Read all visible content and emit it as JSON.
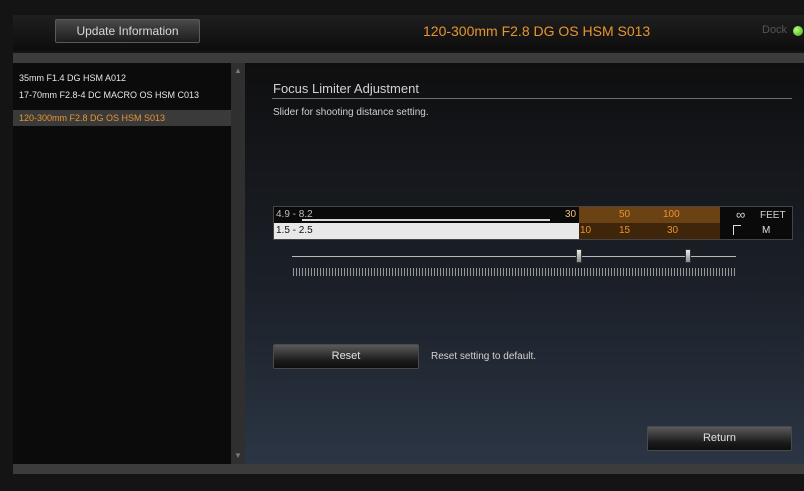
{
  "header": {
    "update_button": "Update Information",
    "lens_title": "120-300mm F2.8 DG OS HSM S013",
    "dock_label": "Dock",
    "dock_status_color": "#4fc21e"
  },
  "sidebar": {
    "items": [
      {
        "label": "35mm F1.4 DG HSM A012",
        "selected": false
      },
      {
        "label": "17-70mm F2.8-4 DC MACRO OS HSM C013",
        "selected": false
      },
      {
        "label": "120-300mm F2.8 DG OS HSM S013",
        "selected": true
      }
    ],
    "scroll_up_icon": "arrow-up-icon",
    "scroll_down_icon": "arrow-down-icon"
  },
  "main": {
    "section_title": "Focus Limiter Adjustment",
    "section_desc": "Slider for shooting distance setting.",
    "scale": {
      "feet_row_left": "4.9 - 8.2",
      "meter_row_left": "1.5 - 2.5",
      "feet_values": [
        "30",
        "50",
        "100"
      ],
      "meter_values": [
        "10",
        "15",
        "30"
      ],
      "infinity_symbol": "∞",
      "feet_unit": "FEET",
      "meter_unit": "M"
    },
    "reset_button": "Reset",
    "reset_desc": "Reset setting to default.",
    "return_button": "Return"
  },
  "colors": {
    "accent": "#e8952e",
    "background": "#141414",
    "selected_item_bg": "#3a3a3a"
  }
}
